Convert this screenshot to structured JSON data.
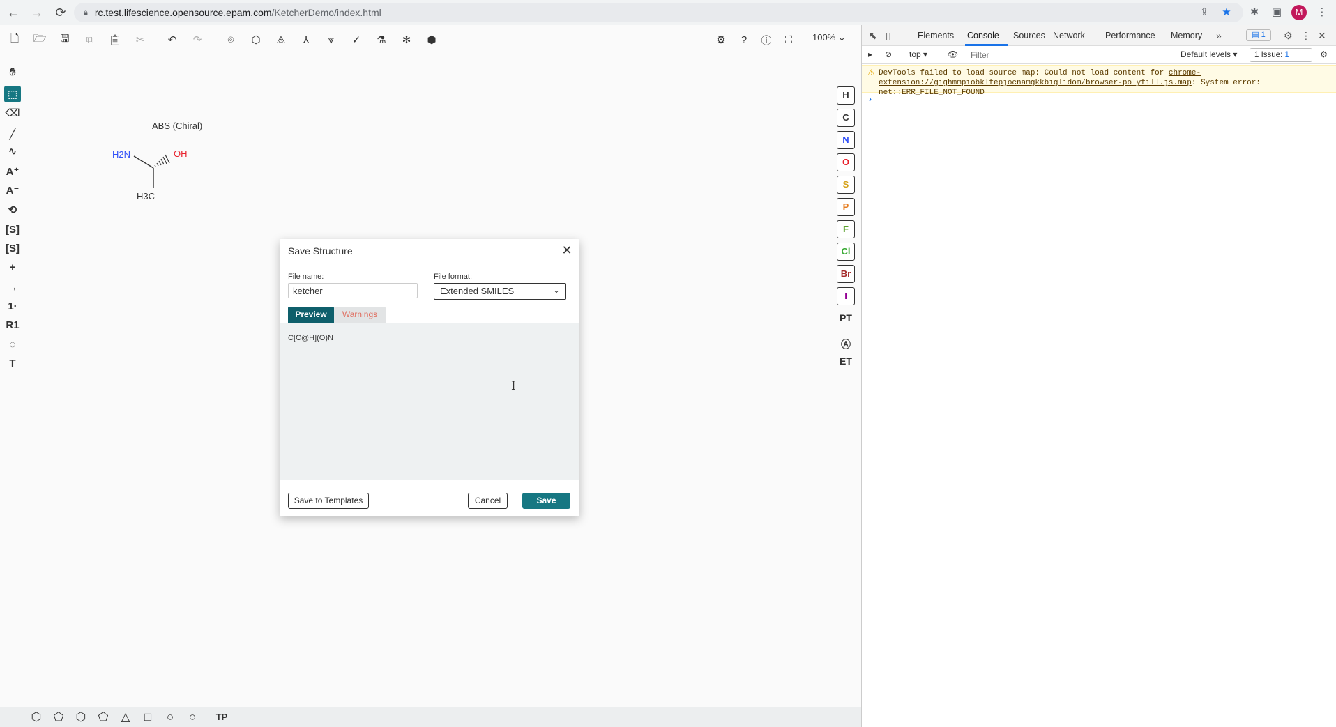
{
  "browser": {
    "url_host": "rc.test.lifescience.opensource.epam.com",
    "url_path": "/KetcherDemo/index.html",
    "avatar_letter": "M"
  },
  "ketcher": {
    "zoom": "100%",
    "structure": {
      "chiral_label": "ABS (Chiral)",
      "atom_amine": "H2N",
      "atom_hydroxyl": "OH",
      "atom_methyl": "H3C"
    },
    "elements": [
      "H",
      "C",
      "N",
      "O",
      "S",
      "P",
      "F",
      "Cl",
      "Br",
      "I"
    ],
    "element_colors": {
      "H": "#333333",
      "C": "#333333",
      "N": "#3050f8",
      "O": "#e8202c",
      "S": "#d4a017",
      "P": "#e67e22",
      "F": "#5aa02c",
      "Cl": "#3aaa35",
      "Br": "#a52a2a",
      "I": "#940094"
    },
    "right_tools": {
      "periodic_table": "PT",
      "extended_table": "ET"
    },
    "bottom_tools": {
      "template_label": "TP"
    }
  },
  "modal": {
    "title": "Save Structure",
    "file_name_label": "File name:",
    "file_name_value": "ketcher",
    "file_format_label": "File format:",
    "file_format_value": "Extended SMILES",
    "tab_preview": "Preview",
    "tab_warnings": "Warnings",
    "preview_text": "C[C@H](O)N",
    "save_to_templates": "Save to Templates",
    "cancel": "Cancel",
    "save": "Save"
  },
  "devtools": {
    "tabs": [
      "Elements",
      "Console",
      "Sources",
      "Network",
      "Performance",
      "Memory"
    ],
    "active_tab": "Console",
    "message_count": "1",
    "context": "top",
    "filter_placeholder": "Filter",
    "levels": "Default levels",
    "issues_label": "1 Issue:",
    "issues_count": "1",
    "warning_prefix": "DevTools failed to load source map: Could not load content for ",
    "warning_link": "chrome-extension://gighmmpiobklfepjocnamgkkbiglidom/browser-polyfill.js.map",
    "warning_suffix": ": System error: net::ERR_FILE_NOT_FOUND"
  }
}
